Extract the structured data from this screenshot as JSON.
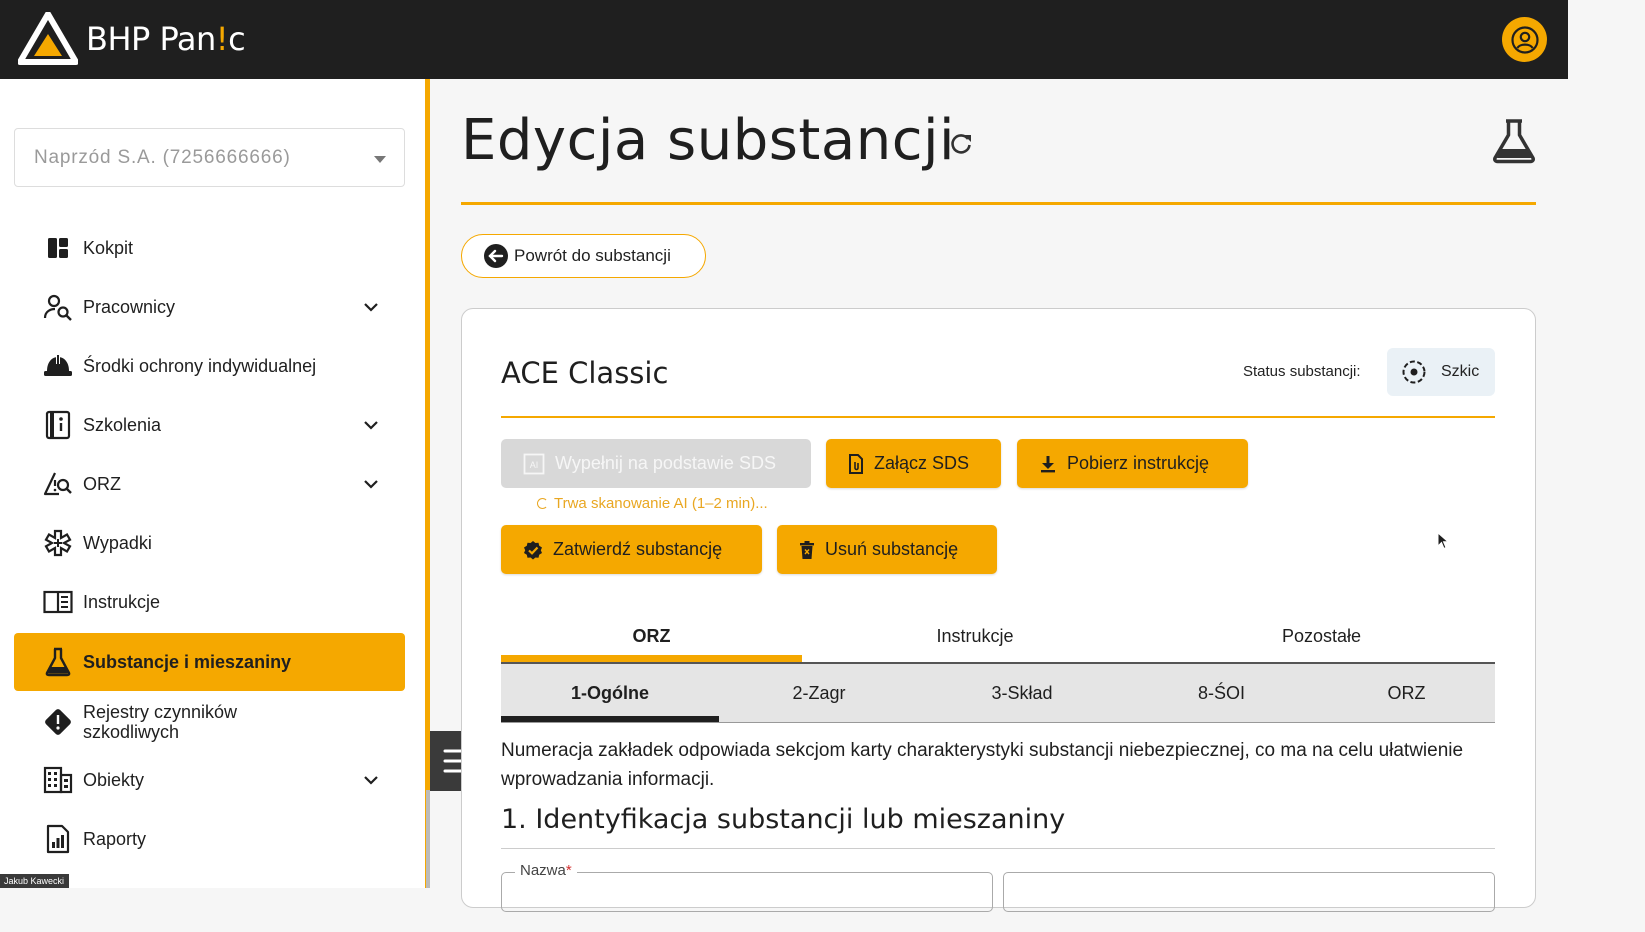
{
  "app": {
    "logo_text": "BHP Pan",
    "logo_excl": "!",
    "logo_suffix": "c"
  },
  "company_select": {
    "value": "Naprzód S.A. (7256666666)"
  },
  "sidebar": {
    "items": [
      {
        "label": "Kokpit",
        "icon": "dashboard-icon"
      },
      {
        "label": "Pracownicy",
        "icon": "people-search-icon",
        "expandable": true
      },
      {
        "label": "Środki ochrony indywidualnej",
        "icon": "helmet-icon"
      },
      {
        "label": "Szkolenia",
        "icon": "training-book-icon",
        "expandable": true
      },
      {
        "label": "ORZ",
        "icon": "risk-search-icon",
        "expandable": true
      },
      {
        "label": "Wypadki",
        "icon": "medical-star-icon"
      },
      {
        "label": "Instrukcje",
        "icon": "instruction-book-icon"
      },
      {
        "label": "Substancje i mieszaniny",
        "icon": "flask-icon",
        "active": true
      },
      {
        "label": "Rejestry czynników szkodliwych",
        "icon": "warning-diamond-icon"
      },
      {
        "label": "Obiekty",
        "icon": "building-icon",
        "expandable": true
      },
      {
        "label": "Raporty",
        "icon": "report-icon"
      }
    ]
  },
  "header": {
    "title": "Edycja substancji"
  },
  "back_button": {
    "label": "Powrót do substancji"
  },
  "substance": {
    "name": "ACE Classic",
    "status_label": "Status substancji:",
    "status_value": "Szkic"
  },
  "actions": {
    "fill_sds": "Wypełnij na podstawie SDS",
    "scan_note": "Trwa skanowanie AI (1–2 min)...",
    "attach_sds": "Załącz SDS",
    "download_instruction": "Pobierz instrukcję",
    "approve": "Zatwierdź substancję",
    "delete": "Usuń substancję"
  },
  "tabs": [
    "ORZ",
    "Instrukcje",
    "Pozostałe"
  ],
  "subtabs": [
    "1-Ogólne",
    "2-Zagr",
    "3-Skład",
    "8-ŚOI",
    "ORZ"
  ],
  "info_text": "Numeracja zakładek odpowiada sekcjom karty charakterystyki substancji niebezpiecznej, co ma na celu ułatwienie wprowadzania informacji.",
  "section": {
    "heading": "1. Identyfikacja substancji lub mieszaniny",
    "name_field_label": "Nazwa",
    "required_mark": "*"
  },
  "presenter": {
    "name": "Jakub Kawecki"
  },
  "colors": {
    "accent": "#f5a800",
    "topbar": "#1f1f1f"
  }
}
